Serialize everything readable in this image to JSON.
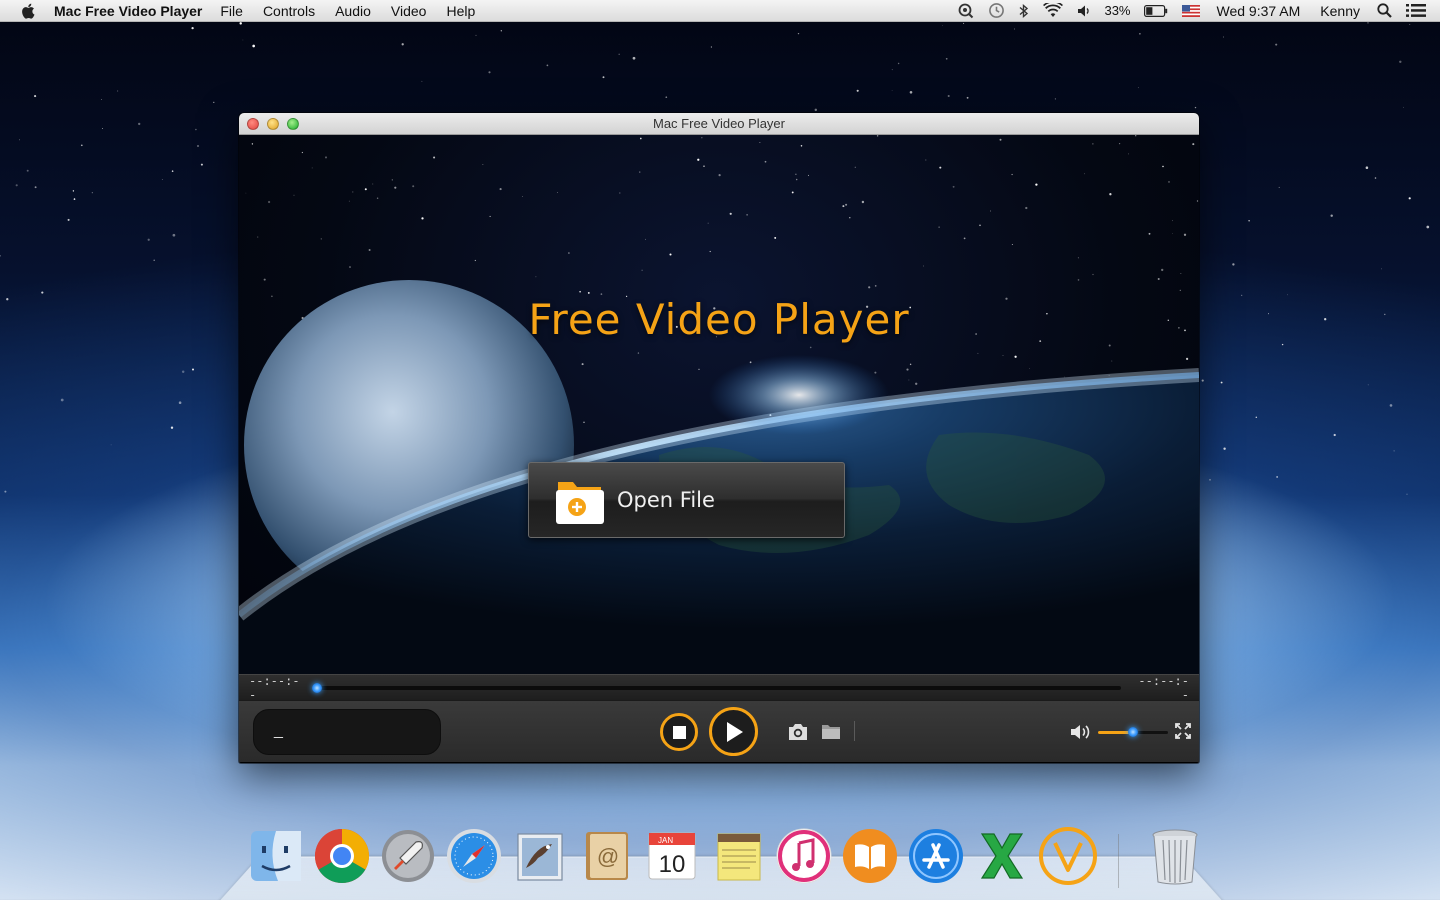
{
  "menubar": {
    "app_name": "Mac Free Video Player",
    "items": [
      "File",
      "Controls",
      "Audio",
      "Video",
      "Help"
    ],
    "status": {
      "battery_text": "33%",
      "clock": "Wed 9:37 AM",
      "user": "Kenny"
    }
  },
  "window": {
    "title": "Mac Free Video Player",
    "player_title": "Free Video Player",
    "open_file_label": "Open File",
    "time_elapsed": "--:--:--",
    "time_remaining": "--:--:--",
    "info_text": "_",
    "seek_position": 0.0,
    "volume_level": 0.5
  },
  "colors": {
    "accent": "#f5a316",
    "knob": "#3a9bff"
  },
  "dock": {
    "items": [
      {
        "icon": "finder-icon"
      },
      {
        "icon": "chrome-icon"
      },
      {
        "icon": "launchpad-icon"
      },
      {
        "icon": "safari-icon"
      },
      {
        "icon": "mail-icon"
      },
      {
        "icon": "contacts-icon"
      },
      {
        "icon": "calendar-icon",
        "month": "JAN",
        "day": "10"
      },
      {
        "icon": "notes-icon"
      },
      {
        "icon": "itunes-icon"
      },
      {
        "icon": "ibooks-icon"
      },
      {
        "icon": "app-store-icon"
      },
      {
        "icon": "excel-icon"
      },
      {
        "icon": "video-player-icon"
      }
    ],
    "trash_icon": "trash-icon"
  }
}
